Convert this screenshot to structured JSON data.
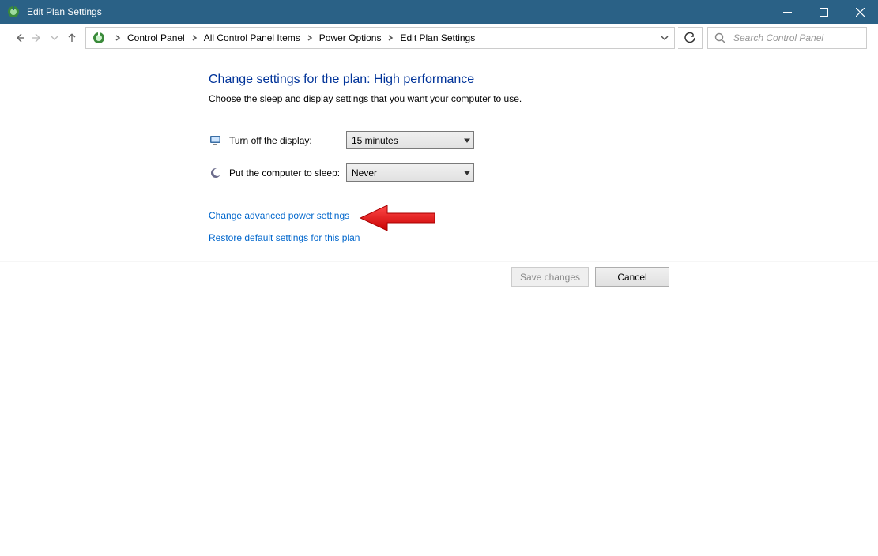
{
  "window": {
    "title": "Edit Plan Settings"
  },
  "breadcrumb": {
    "items": [
      "Control Panel",
      "All Control Panel Items",
      "Power Options",
      "Edit Plan Settings"
    ]
  },
  "search": {
    "placeholder": "Search Control Panel"
  },
  "page": {
    "heading": "Change settings for the plan: High performance",
    "subheading": "Choose the sleep and display settings that you want your computer to use."
  },
  "settings": {
    "display_off": {
      "label": "Turn off the display:",
      "value": "15 minutes"
    },
    "sleep": {
      "label": "Put the computer to sleep:",
      "value": "Never"
    }
  },
  "links": {
    "advanced": "Change advanced power settings",
    "restore": "Restore default settings for this plan"
  },
  "buttons": {
    "save": "Save changes",
    "cancel": "Cancel"
  }
}
